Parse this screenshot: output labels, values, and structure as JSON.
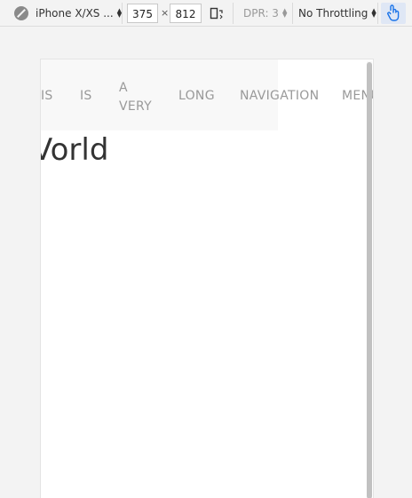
{
  "toolbar": {
    "device_label": "iPhone X/XS ...",
    "width_value": "375",
    "times_symbol": "×",
    "height_value": "812",
    "dpr_label": "DPR: 3",
    "throttling_label": "No Throttling",
    "icons": {
      "location": "no-geolocation-icon",
      "rotate": "rotate-device-icon",
      "touch": "touch-icon"
    },
    "accent_color": "#1a73e8"
  },
  "page": {
    "nav_items": [
      "IS",
      "IS",
      "A\nVERY",
      "LONG",
      "NAVIGATION",
      "MENU"
    ],
    "heading": "Vorld"
  }
}
